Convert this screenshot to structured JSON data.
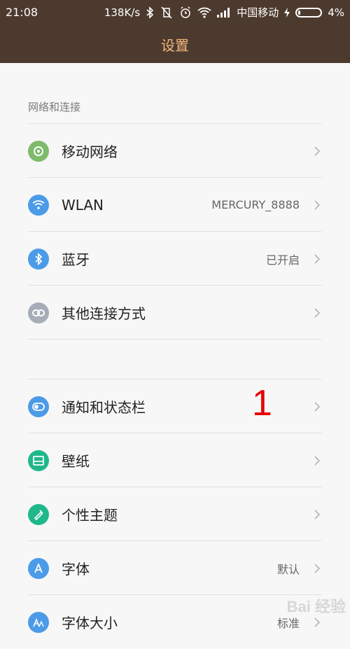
{
  "status_bar": {
    "time": "21:08",
    "speed": "138K/s",
    "carrier": "中国移动",
    "battery_pct": "4%"
  },
  "title": "设置",
  "sections": [
    {
      "label": "网络和连接",
      "items": [
        {
          "label": "移动网络",
          "value": "",
          "icon": "mobile-network-icon",
          "color": "#7dbb6a"
        },
        {
          "label": "WLAN",
          "value": "MERCURY_8888",
          "icon": "wifi-icon",
          "color": "#4b9be8"
        },
        {
          "label": "蓝牙",
          "value": "已开启",
          "icon": "bluetooth-icon",
          "color": "#4b9be8"
        },
        {
          "label": "其他连接方式",
          "value": "",
          "icon": "link-icon",
          "color": "#a7adb8"
        }
      ]
    },
    {
      "label": "",
      "items": [
        {
          "label": "通知和状态栏",
          "value": "",
          "icon": "toggle-icon",
          "color": "#4b9be8"
        },
        {
          "label": "壁纸",
          "value": "",
          "icon": "wallpaper-icon",
          "color": "#1fb88a"
        },
        {
          "label": "个性主题",
          "value": "",
          "icon": "theme-brush-icon",
          "color": "#1fb88a"
        },
        {
          "label": "字体",
          "value": "默认",
          "icon": "font-a-icon",
          "color": "#4b9be8"
        },
        {
          "label": "字体大小",
          "value": "标准",
          "icon": "font-size-icon",
          "color": "#4b9be8"
        }
      ]
    }
  ],
  "annotation": "1",
  "watermark": "Bai 经验"
}
